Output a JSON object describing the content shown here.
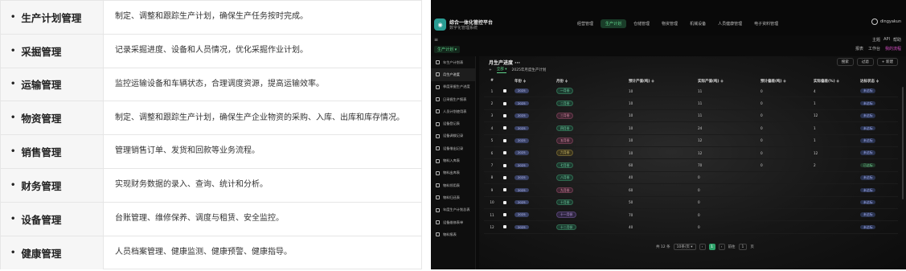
{
  "features": [
    {
      "name": "生产计划管理",
      "desc": "制定、调整和跟踪生产计划，确保生产任务按时完成。"
    },
    {
      "name": "采掘管理",
      "desc": "记录采掘进度、设备和人员情况，优化采掘作业计划。"
    },
    {
      "name": "运输管理",
      "desc": "监控运输设备和车辆状态，合理调度资源，提高运输效率。"
    },
    {
      "name": "物资管理",
      "desc": "制定、调整和跟踪生产计划，确保生产企业物资的采购、入库、出库和库存情况。"
    },
    {
      "name": "销售管理",
      "desc": "管理销售订单、发货和回款等业务流程。"
    },
    {
      "name": "财务管理",
      "desc": "实现财务数据的录入、查询、统计和分析。"
    },
    {
      "name": "设备管理",
      "desc": "台账管理、维修保养、调度与租赁、安全监控。"
    },
    {
      "name": "健康管理",
      "desc": "人员档案管理、健康监测、健康预警、健康指导。"
    }
  ],
  "app": {
    "title": "综合一体化管控平台",
    "subtitle": "数字化管理系统",
    "nav": [
      "经营管理",
      "生产计划",
      "仓储管理",
      "物资管理",
      "机械设备",
      "人员健康管理",
      "电子资料管理"
    ],
    "active_nav": 1,
    "user": "dingyakun",
    "util_links": [
      "主题",
      "API",
      "帮助"
    ],
    "breadcrumb": "生产计划 ▾",
    "quick_actions": [
      "报表",
      "工作台",
      "我的流程"
    ],
    "sidebar": [
      "年生产计划表",
      "月生产进度",
      "季度采掘生产进度",
      "日采掘生产报表",
      "人员计划使用表",
      "设备登记表",
      "设备调拨记录",
      "设备借出记录",
      "物料入库表",
      "物料出库表",
      "物料领用表",
      "物料归还表",
      "年度生产计划总表",
      "设备维修表单",
      "物料报表"
    ],
    "active_sidebar": 1,
    "page_heading": "月生产进度 ···",
    "toolbar": [
      "搜索",
      "过滤",
      "+ 新建"
    ],
    "filter_tabs": [
      "+",
      "全部 ▾",
      "2025年月度生产计划"
    ],
    "columns": [
      "#",
      "年份 ≑",
      "月份 ≑",
      "预计产值(吨) ≑",
      "实际产值(吨) ≑",
      "预计偏差(吨) ≑",
      "实际偏差(%) ≑",
      "达标状态 ≑"
    ],
    "rows": [
      {
        "idx": "1",
        "year": "2025",
        "month": "一月份",
        "tone": "",
        "plan": "10",
        "actual": "11",
        "diff": "0",
        "pct": "4",
        "status": "未达标"
      },
      {
        "idx": "2",
        "year": "2025",
        "month": "二月份",
        "tone": "",
        "plan": "10",
        "actual": "11",
        "diff": "0",
        "pct": "1",
        "status": "未达标"
      },
      {
        "idx": "3",
        "year": "2025",
        "month": "三月份",
        "tone": "warm",
        "plan": "10",
        "actual": "11",
        "diff": "0",
        "pct": "12",
        "status": "未达标"
      },
      {
        "idx": "4",
        "year": "2025",
        "month": "四月份",
        "tone": "",
        "plan": "10",
        "actual": "24",
        "diff": "0",
        "pct": "1",
        "status": "未达标"
      },
      {
        "idx": "5",
        "year": "2025",
        "month": "五月份",
        "tone": "warm",
        "plan": "10",
        "actual": "12",
        "diff": "0",
        "pct": "1",
        "status": "未达标"
      },
      {
        "idx": "6",
        "year": "2025",
        "month": "六月份",
        "tone": "gold",
        "plan": "10",
        "actual": "12",
        "diff": "0",
        "pct": "12",
        "status": "未达标"
      },
      {
        "idx": "7",
        "year": "2025",
        "month": "七月份",
        "tone": "",
        "plan": "60",
        "actual": "70",
        "diff": "0",
        "pct": "2",
        "status": "已达标"
      },
      {
        "idx": "8",
        "year": "2025",
        "month": "八月份",
        "tone": "",
        "plan": "40",
        "actual": "0",
        "diff": "",
        "pct": "",
        "status": "未达标"
      },
      {
        "idx": "9",
        "year": "2025",
        "month": "九月份",
        "tone": "warm",
        "plan": "60",
        "actual": "0",
        "diff": "",
        "pct": "",
        "status": "未达标"
      },
      {
        "idx": "10",
        "year": "2025",
        "month": "十月份",
        "tone": "",
        "plan": "50",
        "actual": "0",
        "diff": "",
        "pct": "",
        "status": "未达标"
      },
      {
        "idx": "11",
        "year": "2025",
        "month": "十一月份",
        "tone": "pur",
        "plan": "70",
        "actual": "0",
        "diff": "",
        "pct": "",
        "status": "未达标"
      },
      {
        "idx": "12",
        "year": "2025",
        "month": "十二月份",
        "tone": "",
        "plan": "40",
        "actual": "0",
        "diff": "",
        "pct": "",
        "status": "未达标"
      }
    ],
    "pager": {
      "total": "共 12 条",
      "page_size": "10条/页 ▾",
      "prev": "‹",
      "current": "1",
      "next": "›",
      "goto_label": "前往",
      "goto_value": "1",
      "goto_suffix": "页"
    }
  }
}
